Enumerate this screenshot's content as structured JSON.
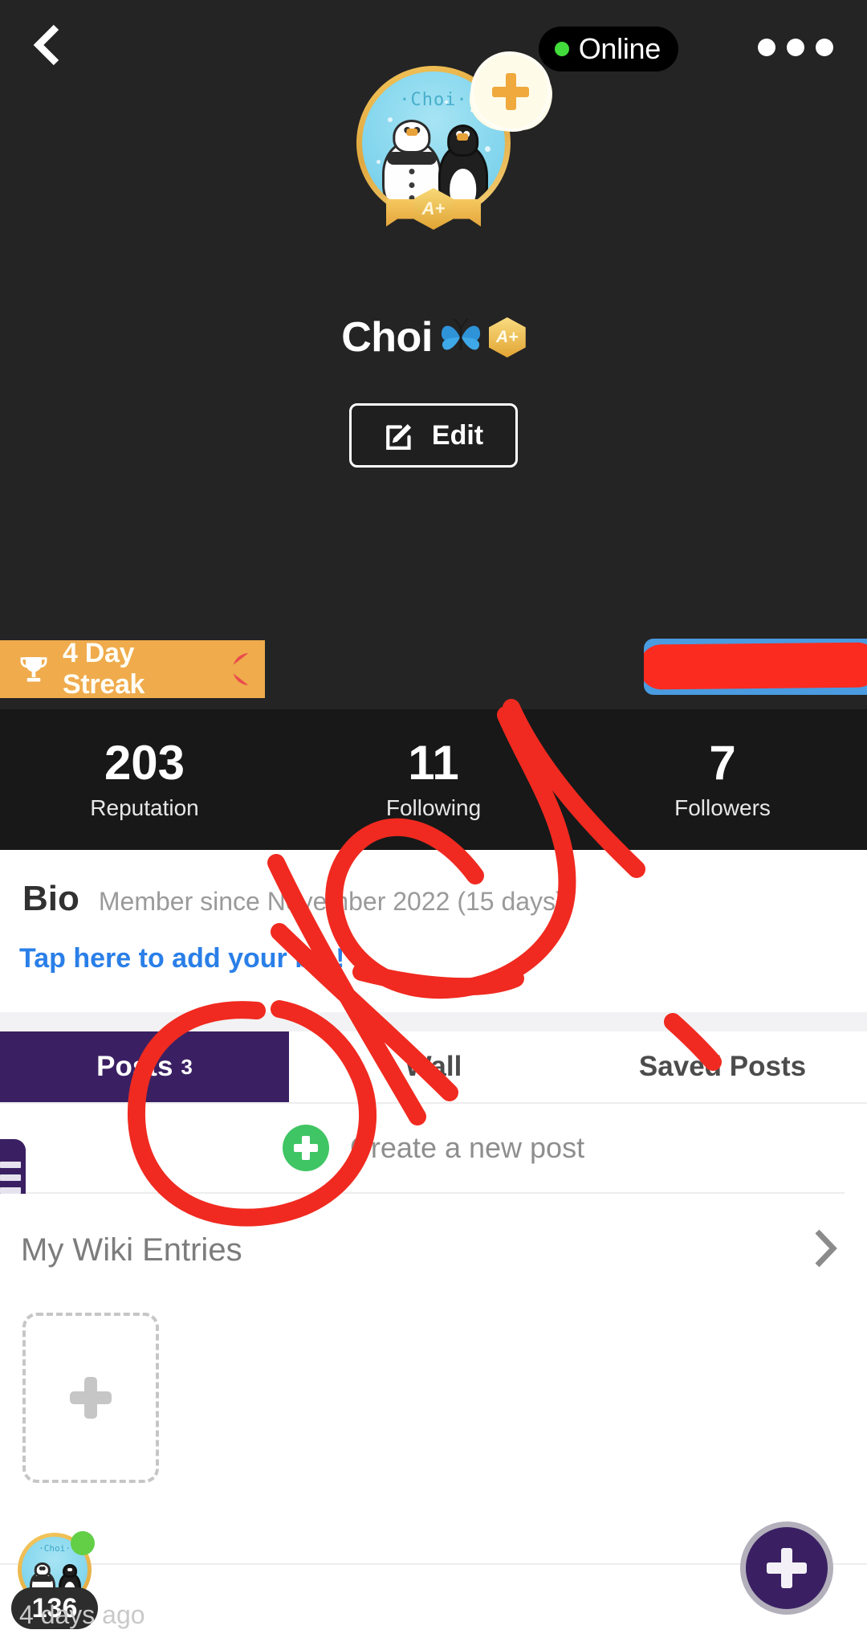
{
  "header": {
    "back_icon": "chevron-left-icon",
    "status_label": "Online",
    "status_dot_color": "#42dd3c",
    "overflow_icon": "more-horizontal-icon",
    "avatar": {
      "inner_caption": "·Choi·",
      "badge_label": "A+",
      "add_story_icon": "plus-icon"
    },
    "display_name": "Choi",
    "name_badges": [
      "butterfly-emoji",
      "a-plus-hex-badge"
    ],
    "name_badge_label": "A+",
    "edit_button": {
      "label": "Edit",
      "icon": "pencil-square-icon"
    }
  },
  "streak": {
    "icon": "trophy-icon",
    "label": "4 Day Streak",
    "alert": "!",
    "color": "#efab4c"
  },
  "promo_banner": {
    "censored": true,
    "background": "#4a9be0",
    "redaction_color": "#fc2b20"
  },
  "stats": [
    {
      "value": "203",
      "caption": "Reputation"
    },
    {
      "value": "11",
      "caption": "Following"
    },
    {
      "value": "7",
      "caption": "Followers"
    }
  ],
  "bio": {
    "title": "Bio",
    "member_since": "Member since November 2022 (15 days)",
    "add_bio_link": "Tap here to add your bio!",
    "link_color": "#2a7fe8"
  },
  "tabs": [
    {
      "label": "Posts",
      "count": "3",
      "active": true
    },
    {
      "label": "Wall",
      "count": "",
      "active": false
    },
    {
      "label": "Saved Posts",
      "count": "",
      "active": false
    }
  ],
  "tab_active_color": "#3a2063",
  "create_post": {
    "icon": "plus-circle-icon",
    "label": "Create a new post"
  },
  "drawer_handle": {
    "icon": "hamburger-icon"
  },
  "wiki": {
    "title": "My Wiki Entries",
    "chevron_icon": "chevron-right-icon",
    "add_card_icon": "plus-icon"
  },
  "footer": {
    "mini_avatar_caption": "·Choi·",
    "count_badge": "136",
    "time_ago": "4 days ago",
    "fab_icon": "plus-icon",
    "fab_color": "#3a2063"
  }
}
